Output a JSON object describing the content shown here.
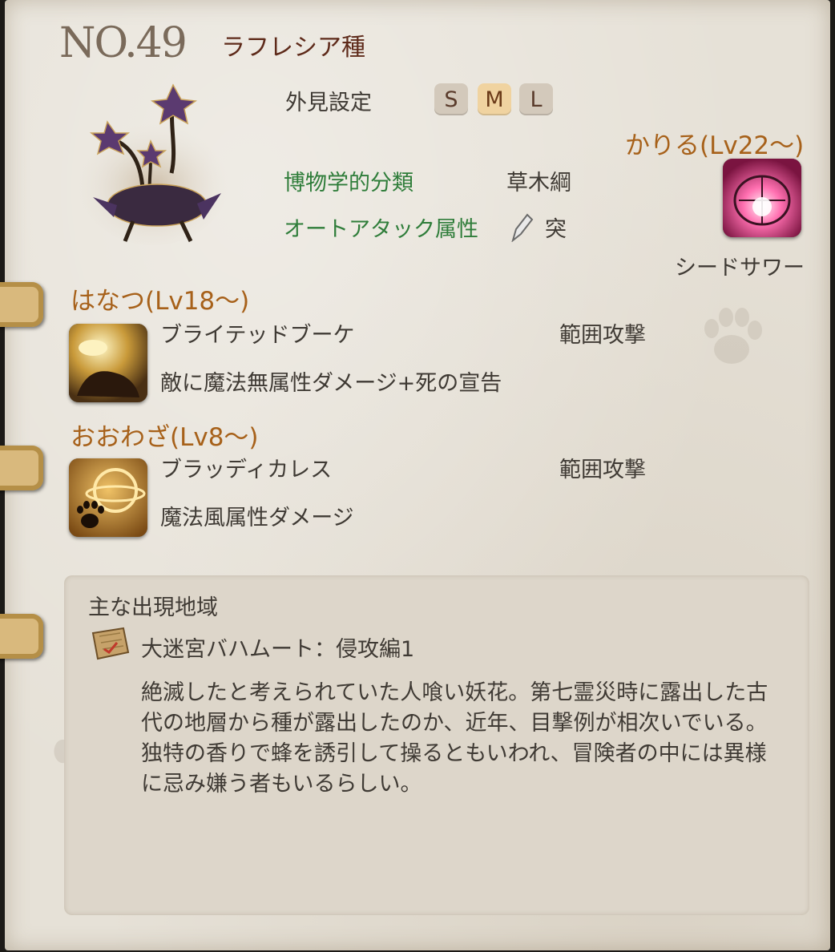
{
  "entry": {
    "number": "NO.49",
    "name": "ラフレシア種"
  },
  "appearance": {
    "label": "外見設定",
    "sizes": [
      "S",
      "M",
      "L"
    ],
    "selected": "M"
  },
  "classification": {
    "label": "博物学的分類",
    "value": "草木綱"
  },
  "auto_attack": {
    "label": "オートアタック属性",
    "value": "突",
    "icon": "pierce-icon"
  },
  "karu": {
    "heading": "かりる(Lv22～)",
    "skill_name": "シードサワー",
    "icon": "seed-shower-icon"
  },
  "skills": [
    {
      "heading": "はなつ(Lv18～)",
      "name": "ブライテッドブーケ",
      "type": "範囲攻撃",
      "description": "敵に魔法無属性ダメージ+死の宣告",
      "icon": "blighted-bouquet-icon"
    },
    {
      "heading": "おおわざ(Lv8～)",
      "name": "ブラッディカレス",
      "type": "範囲攻撃",
      "description": "魔法風属性ダメージ",
      "icon": "bloody-caress-icon"
    }
  ],
  "region": {
    "title": "主な出現地域",
    "name": "大迷宮バハムート：侵攻編1",
    "icon": "map-scroll-icon",
    "description_lines": [
      "絶滅したと考えられていた人喰い妖花。第七霊災時に露出した古",
      "代の地層から種が露出したのか、近年、目撃例が相次いでいる。",
      "独特の香りで蜂を誘引して操るともいわれ、冒険者の中には異様",
      "に忌み嫌う者もいるらしい。"
    ]
  },
  "decor": {
    "paw_icon": "paw-print-icon",
    "binder_ring": "binder-ring"
  }
}
